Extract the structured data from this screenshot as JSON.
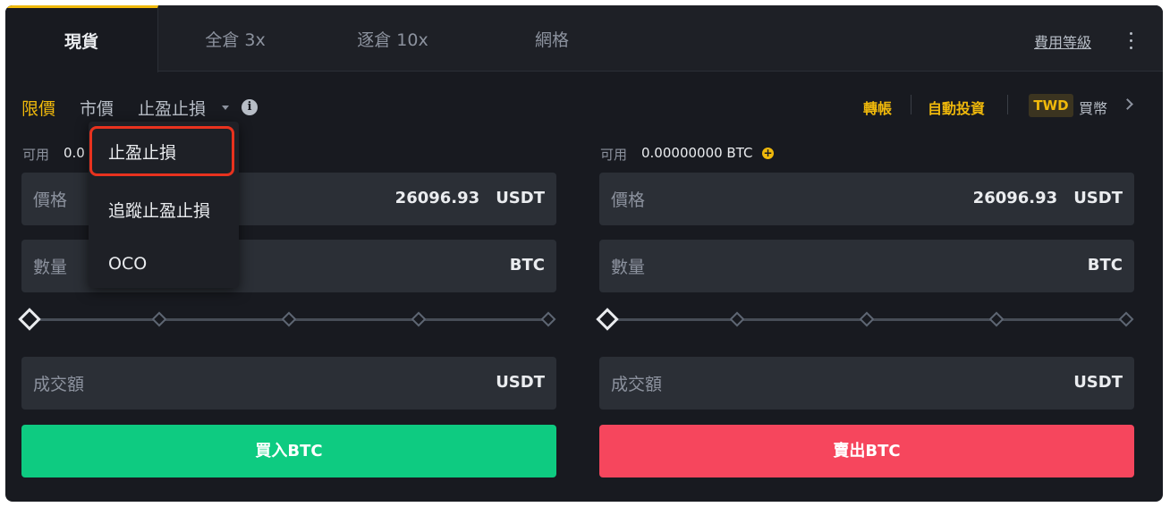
{
  "tabs": [
    {
      "label": "現貨",
      "active": true
    },
    {
      "label": "全倉 3x",
      "active": false
    },
    {
      "label": "逐倉 10x",
      "active": false
    },
    {
      "label": "網格",
      "active": false
    }
  ],
  "fee_level": "費用等級",
  "order_types": {
    "limit": "限價",
    "market": "市價",
    "stop": "止盈止損"
  },
  "right_links": {
    "transfer": "轉帳",
    "auto_invest": "自動投資",
    "currency": "TWD",
    "buy_coin": "買幣"
  },
  "dropdown": {
    "items": [
      "止盈止損",
      "追蹤止盈止損",
      "OCO"
    ],
    "highlighted": "止盈止損"
  },
  "buy_panel": {
    "available_label": "可用",
    "available_value": "0.0",
    "price_label": "價格",
    "price_value": "26096.93",
    "price_unit": "USDT",
    "amount_label": "數量",
    "amount_unit": "BTC",
    "total_label": "成交額",
    "total_unit": "USDT",
    "slider_percent": 0,
    "button": "買入BTC"
  },
  "sell_panel": {
    "available_label": "可用",
    "available_value": "0.00000000 BTC",
    "price_label": "價格",
    "price_value": "26096.93",
    "price_unit": "USDT",
    "amount_label": "數量",
    "amount_unit": "BTC",
    "total_label": "成交額",
    "total_unit": "USDT",
    "slider_percent": 0,
    "button": "賣出BTC"
  },
  "colors": {
    "accent": "#f0b90b",
    "buy": "#0ecb81",
    "sell": "#f6465d",
    "highlight": "#e8321e"
  }
}
